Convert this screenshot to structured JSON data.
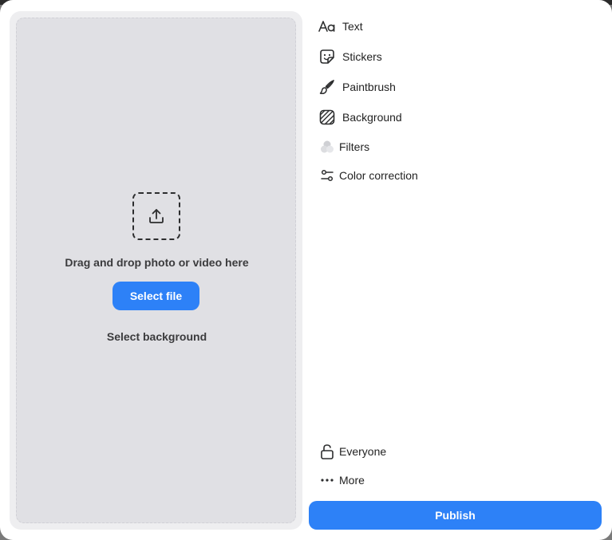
{
  "drop_zone": {
    "prompt": "Drag and drop photo or video here",
    "select_file_label": "Select file",
    "select_background_label": "Select background"
  },
  "tools": [
    {
      "label": "Text",
      "icon": "text-aa-icon"
    },
    {
      "label": "Stickers",
      "icon": "sticker-icon"
    },
    {
      "label": "Paintbrush",
      "icon": "paintbrush-icon"
    },
    {
      "label": "Background",
      "icon": "hatched-background-icon"
    },
    {
      "label": "Filters",
      "icon": "filters-circles-icon"
    },
    {
      "label": "Color correction",
      "icon": "sliders-icon"
    }
  ],
  "privacy": {
    "label": "Everyone",
    "icon": "unlock-icon"
  },
  "more": {
    "label": "More",
    "icon": "more-dots-icon"
  },
  "publish_label": "Publish",
  "colors": {
    "accent": "#2d81f7",
    "drop_zone": "#e0e0e4",
    "panel": "#eeeef0"
  }
}
